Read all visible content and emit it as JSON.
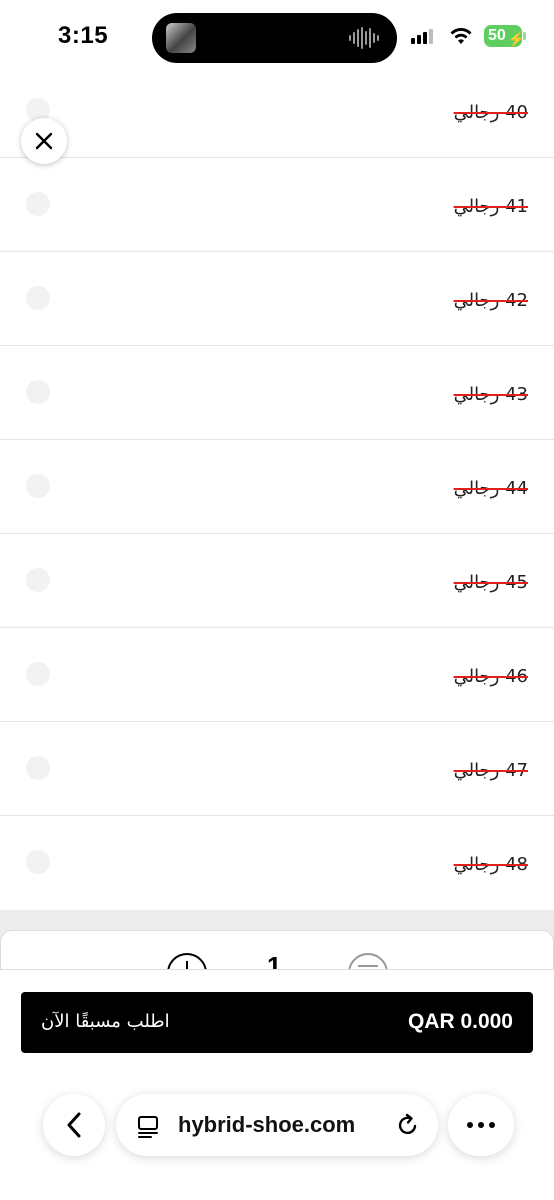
{
  "status_bar": {
    "time": "3:15",
    "battery": "50"
  },
  "size_options": [
    {
      "label": "40 رجالي"
    },
    {
      "label": "41 رجالي"
    },
    {
      "label": "42 رجالي"
    },
    {
      "label": "43 رجالي"
    },
    {
      "label": "44 رجالي"
    },
    {
      "label": "45 رجالي"
    },
    {
      "label": "46 رجالي"
    },
    {
      "label": "47 رجالي"
    },
    {
      "label": "48 رجالي"
    }
  ],
  "quantity": {
    "value": "1"
  },
  "preorder": {
    "label": "اطلب مسبقًا الآن",
    "price": "QAR 0.000"
  },
  "browser": {
    "url": "hybrid-shoe.com"
  },
  "colors": {
    "strike": "#e02020",
    "button_bg": "#000000",
    "battery": "#5ecf5e"
  }
}
